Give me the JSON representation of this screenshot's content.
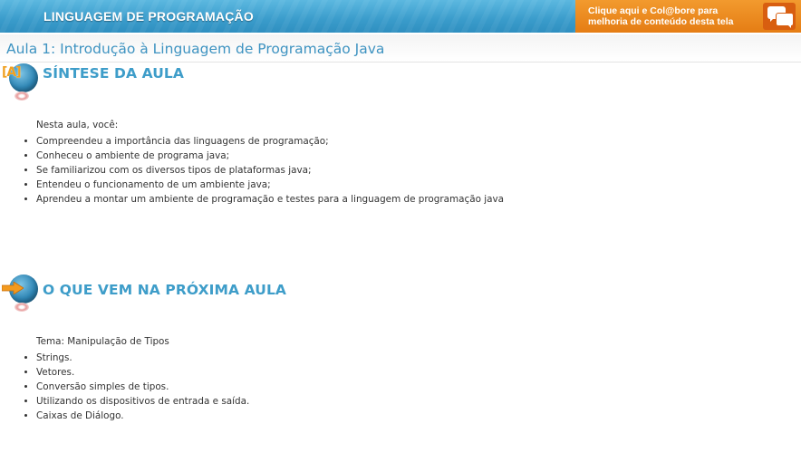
{
  "header": {
    "course_title": "LINGUAGEM DE PROGRAMAÇÃO",
    "feedback_line1": "Clique aqui e Col@bore para",
    "feedback_line2": "melhoria de conteúdo desta tela",
    "feedback_icon": "chat-bubbles-icon",
    "colors": {
      "bar": "#3a9ccb",
      "feedback": "#e57d14"
    }
  },
  "lesson": {
    "title": "Aula 1: Introdução à Linguagem de Programação Java"
  },
  "synthesis": {
    "badge": "[A]",
    "title": "SÍNTESE DA AULA",
    "intro": "Nesta aula, você:",
    "items": [
      "Compreendeu a importância das linguagens de programação;",
      "Conheceu o ambiente de programa java;",
      "Se familiarizou com os diversos tipos de plataformas java;",
      "Entendeu o funcionamento de um ambiente java;",
      "Aprendeu a montar um ambiente de programação e testes para a linguagem de programação java"
    ]
  },
  "next": {
    "title": "O QUE VEM NA PRÓXIMA AULA",
    "intro": "Tema: Manipulação de Tipos",
    "items": [
      "Strings.",
      "Vetores.",
      "Conversão simples de tipos.",
      "Utilizando os dispositivos de entrada e saída.",
      "Caixas de Diálogo."
    ]
  }
}
